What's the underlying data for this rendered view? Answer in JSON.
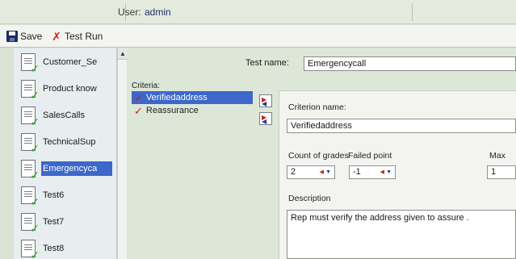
{
  "header": {
    "user_label": "User:",
    "user_value": "admin"
  },
  "toolbar": {
    "save_label": "Save",
    "test_run_label": "Test Run"
  },
  "sidebar": {
    "items": [
      {
        "label": "Customer_Se",
        "selected": false
      },
      {
        "label": "Product know",
        "selected": false
      },
      {
        "label": "SalesCalls",
        "selected": false
      },
      {
        "label": "TechnicalSup",
        "selected": false
      },
      {
        "label": "Emergencyca",
        "selected": true
      },
      {
        "label": "Test6",
        "selected": false
      },
      {
        "label": "Test7",
        "selected": false
      },
      {
        "label": "Test8",
        "selected": false
      }
    ]
  },
  "test": {
    "name_label": "Test name:",
    "name_value": "Emergencycall"
  },
  "criteria": {
    "label": "Criteria:",
    "items": [
      {
        "label": "Verifiedaddress",
        "selected": true
      },
      {
        "label": "Reassurance",
        "selected": false
      }
    ]
  },
  "criterion": {
    "name_label": "Criterion name:",
    "name_value": "Verifiedaddress",
    "count_label": "Count of grades",
    "count_value": "2",
    "failed_label": "Failed point",
    "failed_value": "-1",
    "max_label": "Max",
    "max_value": "1",
    "description_label": "Description",
    "description_value": "Rep must verify the address given to assure ."
  },
  "colors": {
    "selection": "#3d67c9",
    "background": "#d8e3d4",
    "check_green": "#2f9c2a",
    "check_red": "#c42018"
  },
  "icons": {
    "save": "save-icon",
    "test_run": "test-run-icon",
    "document": "document-check-icon",
    "criterion_check": "red-check-icon",
    "move": "move-arrows-icon"
  }
}
